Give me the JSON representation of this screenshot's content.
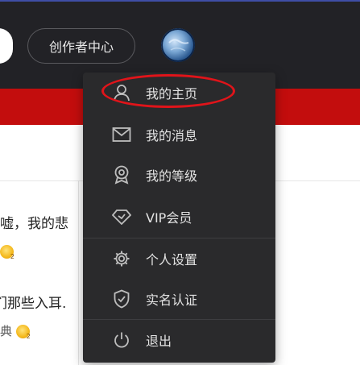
{
  "header": {
    "creator_button": "创作者中心",
    "avatar_name": "avatar"
  },
  "content": {
    "line1": "嘘，我的悲",
    "line2": "们那些入耳.",
    "line3": "典"
  },
  "menu": {
    "items": [
      {
        "label": "我的主页",
        "icon": "user-icon"
      },
      {
        "label": "我的消息",
        "icon": "mail-icon"
      },
      {
        "label": "我的等级",
        "icon": "badge-icon"
      },
      {
        "label": "VIP会员",
        "icon": "diamond-icon"
      },
      {
        "label": "个人设置",
        "icon": "gear-icon"
      },
      {
        "label": "实名认证",
        "icon": "shield-check-icon"
      },
      {
        "label": "退出",
        "icon": "power-icon"
      }
    ]
  },
  "colors": {
    "header_bg": "#222226",
    "red_band": "#c30d0d",
    "menu_bg": "#2a2a2c",
    "highlight": "#e0141a"
  }
}
